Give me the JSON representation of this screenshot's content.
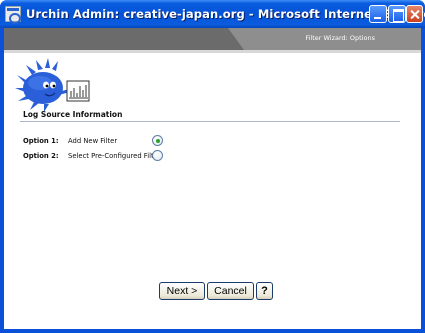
{
  "window": {
    "title": "Urchin Admin: creative-japan.org - Microsoft Internet Explorer",
    "controls": [
      "minimize-icon",
      "maximize-icon",
      "close-icon"
    ]
  },
  "header": {
    "wizard_title": "Filter Wizard: Options"
  },
  "section": {
    "title": "Log Source Information",
    "options": [
      {
        "name": "Option 1:",
        "description": "Add New Filter",
        "selected": true
      },
      {
        "name": "Option 2:",
        "description": "Select Pre-Configured Filter",
        "selected": false
      }
    ]
  },
  "buttons": {
    "next": "Next >",
    "cancel": "Cancel",
    "help": "?"
  },
  "colors": {
    "titlebar": "#0a5ce0",
    "header_dark": "#6b6b6b",
    "header_tab": "#8e8e8e",
    "radio_selected": "#2ea02e",
    "logo_blue": "#2b5fd9"
  },
  "icons": {
    "app": "ie-page-icon",
    "logo": "urchin-mascot-icon"
  }
}
